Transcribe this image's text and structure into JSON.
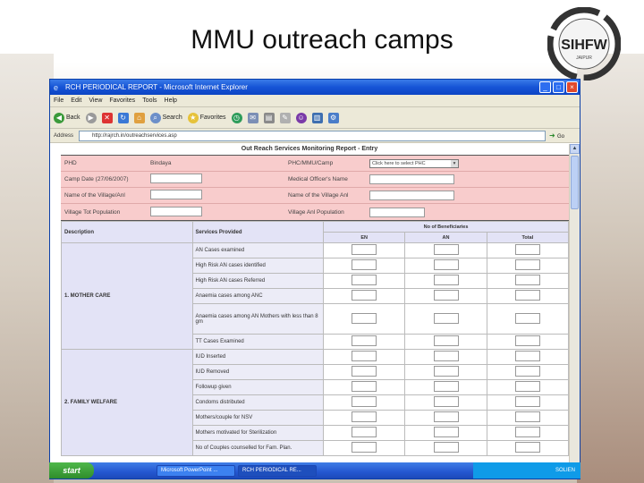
{
  "slide": {
    "title": "MMU outreach camps"
  },
  "logo": {
    "text": "SIHFW",
    "subtext": "JAIPUR"
  },
  "browser": {
    "window_title": "RCH PERIODICAL REPORT - Microsoft Internet Explorer",
    "menu": [
      "File",
      "Edit",
      "View",
      "Favorites",
      "Tools",
      "Help"
    ],
    "toolbar": {
      "back": "Back",
      "search": "Search",
      "favorites": "Favorites"
    },
    "address_label": "Address",
    "address_value": "http://rajrch.in/outreachservices.asp",
    "go_label": "Go"
  },
  "report": {
    "title": "Out Reach Services Monitoring Report - Entry",
    "header_rows": [
      {
        "left_label": "PHD",
        "left_value": "Bindaya",
        "right_label": "PHC/MMU/Camp",
        "right_type": "select",
        "right_value": "Click here to select PHC"
      },
      {
        "left_label": "Camp Date (27/06/2007)",
        "left_value": "",
        "right_label": "Medical Officer's Name",
        "right_type": "input"
      },
      {
        "left_label": "Name of the Village/Anl",
        "left_value": "",
        "right_label": "Name of the Village Anl",
        "right_type": "input"
      },
      {
        "left_label": "Village Tot Population",
        "left_value": "",
        "right_label": "Village Anl Population",
        "right_type": "input-small"
      }
    ],
    "table": {
      "col_description": "Description",
      "col_services": "Services Provided",
      "col_no_beneficiaries": "No of Beneficiaries",
      "sub_cols": [
        "EN",
        "AN",
        "Total"
      ],
      "groups": [
        {
          "category": "1. MOTHER CARE",
          "services": [
            "AN Cases examined",
            "High Risk AN cases identified",
            "High Risk AN cases Referred",
            "Anaemia cases among ANC",
            "Anaemia cases among AN Mothers with less than 8 gm",
            "TT Cases Examined"
          ]
        },
        {
          "category": "2. FAMILY WELFARE",
          "services": [
            "IUD Inserted",
            "IUD Removed",
            "Followup given",
            "Condoms distributed",
            "Mothers/couple for NSV",
            "Mothers motivated for Sterilization",
            "No of Couples counselled for Fam. Plan."
          ]
        }
      ]
    }
  },
  "taskbar": {
    "start": "start",
    "tasks": [
      "Microsoft PowerPoint ...",
      "RCH PERIODICAL RE..."
    ],
    "clock": "SOLIEN"
  }
}
